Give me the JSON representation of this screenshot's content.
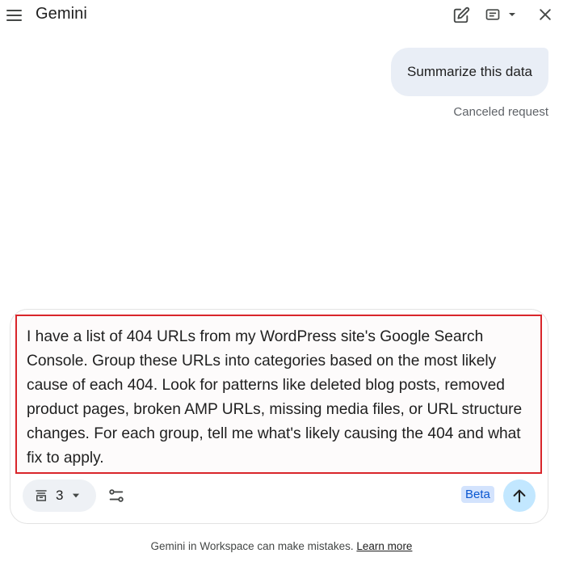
{
  "header": {
    "title": "Gemini",
    "icons": [
      "menu-icon",
      "edit-icon",
      "view-list-icon",
      "close-icon"
    ]
  },
  "chat": {
    "user_message": "Summarize this data",
    "status": "Canceled request"
  },
  "composer": {
    "prompt_text": "I have a list of 404 URLs from my WordPress site's Google Search Console. Group these URLs into categories based on the most likely cause of each 404. Look for patterns like deleted blog posts, removed product pages, broken AMP URLs, missing media files, or URL structure changes. For each group, tell me what's likely causing the 404 and what fix to apply.",
    "source_count": "3",
    "beta_label": "Beta",
    "highlight_color": "#d9262b"
  },
  "footer": {
    "disclaimer": "Gemini in Workspace can make mistakes.",
    "link_text": "Learn more"
  }
}
